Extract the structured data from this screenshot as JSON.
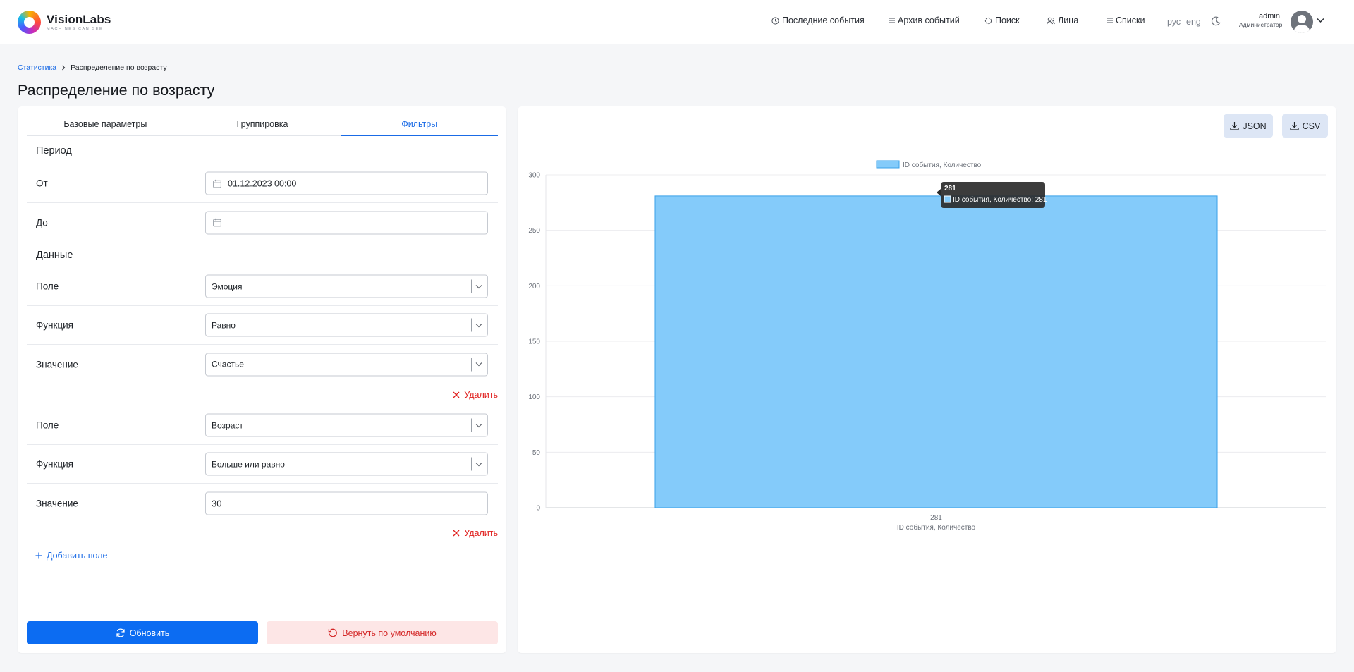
{
  "brand": {
    "name": "VisionLabs",
    "tagline": "MACHINES CAN SEE"
  },
  "nav": {
    "items": [
      {
        "label": "Последние события",
        "icon": "clock-icon"
      },
      {
        "label": "Архив событий",
        "icon": "list-icon"
      },
      {
        "label": "Поиск",
        "icon": "search-icon"
      },
      {
        "label": "Лица",
        "icon": "people-icon"
      },
      {
        "label": "Списки",
        "icon": "list-icon"
      }
    ],
    "lang_ru": "рус",
    "lang_en": "eng"
  },
  "user": {
    "name": "admin",
    "role": "Администратор"
  },
  "breadcrumb": {
    "parent": "Статистика",
    "current": "Распределение по возрасту"
  },
  "page_title": "Распределение по возрасту",
  "tabs": [
    {
      "label": "Базовые параметры",
      "active": false
    },
    {
      "label": "Группировка",
      "active": false
    },
    {
      "label": "Фильтры",
      "active": true
    }
  ],
  "period": {
    "title": "Период",
    "from_label": "От",
    "from_value": "01.12.2023 00:00",
    "to_label": "До",
    "to_value": ""
  },
  "data_section": {
    "title": "Данные",
    "filters": [
      {
        "field_label": "Поле",
        "field_value": "Эмоция",
        "function_label": "Функция",
        "function_value": "Равно",
        "value_label": "Значение",
        "value_value": "Счастье",
        "delete_label": "Удалить"
      },
      {
        "field_label": "Поле",
        "field_value": "Возраст",
        "function_label": "Функция",
        "function_value": "Больше или равно",
        "value_label": "Значение",
        "value_value": "30",
        "delete_label": "Удалить"
      }
    ],
    "add_field_label": "Добавить поле"
  },
  "actions": {
    "refresh_label": "Обновить",
    "reset_label": "Вернуть по умолчанию"
  },
  "export": {
    "json_label": "JSON",
    "csv_label": "CSV"
  },
  "colors": {
    "accent": "#1a6be6",
    "primary_button": "#0c6cf2",
    "danger": "#e0201e",
    "bar_fill": "#84cbfa",
    "bar_stroke": "#3aa0e8"
  },
  "chart_data": {
    "type": "bar",
    "categories": [
      "281"
    ],
    "series": [
      {
        "name": "ID события, Количество",
        "values": [
          281
        ]
      }
    ],
    "xlabel": "ID события, Количество",
    "ylabel": "",
    "ylim": [
      0,
      300
    ],
    "yticks": [
      0,
      50,
      100,
      150,
      200,
      250,
      300
    ],
    "grid": true,
    "legend": "top-center",
    "tooltip": {
      "title": "281",
      "text": "ID события, Количество: 281"
    }
  }
}
